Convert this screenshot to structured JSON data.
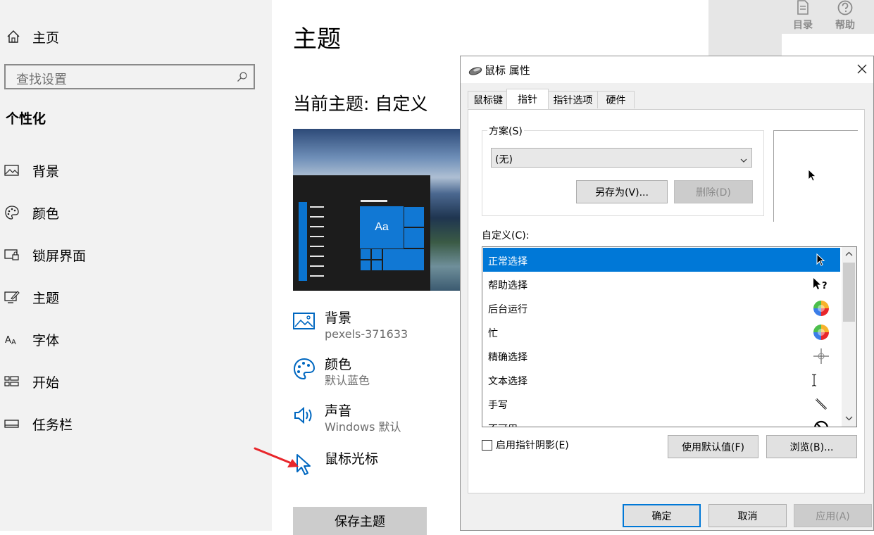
{
  "sidebar": {
    "home_label": "主页",
    "search_placeholder": "查找设置",
    "section_title": "个性化",
    "items": [
      {
        "label": "背景",
        "icon": "picture-icon"
      },
      {
        "label": "颜色",
        "icon": "palette-icon"
      },
      {
        "label": "锁屏界面",
        "icon": "lock-screen-icon"
      },
      {
        "label": "主题",
        "icon": "theme-icon"
      },
      {
        "label": "字体",
        "icon": "font-icon"
      },
      {
        "label": "开始",
        "icon": "start-icon"
      },
      {
        "label": "任务栏",
        "icon": "taskbar-icon"
      }
    ]
  },
  "main": {
    "title": "主题",
    "current_theme": "当前主题: 自定义",
    "preview_tile_text": "Aa",
    "rows": [
      {
        "label": "背景",
        "sub": "pexels-371633",
        "icon": "picture-icon"
      },
      {
        "label": "颜色",
        "sub": "默认蓝色",
        "icon": "palette-icon"
      },
      {
        "label": "声音",
        "sub": "Windows 默认",
        "icon": "speaker-icon"
      },
      {
        "label": "鼠标光标",
        "sub": "",
        "icon": "cursor-icon"
      }
    ],
    "save_button": "保存主题"
  },
  "help_window": {
    "toc": "目录",
    "help": "帮助"
  },
  "dialog": {
    "title": "鼠标 属性",
    "tabs": [
      "鼠标键",
      "指针",
      "指针选项",
      "硬件"
    ],
    "active_tab": "指针",
    "scheme_label": "方案(S)",
    "scheme_value": "(无)",
    "save_as_button": "另存为(V)...",
    "delete_button": "删除(D)",
    "customize_label": "自定义(C):",
    "cursor_list": [
      {
        "label": "正常选择",
        "icon": "arrow-cursor-icon"
      },
      {
        "label": "帮助选择",
        "icon": "help-cursor-icon"
      },
      {
        "label": "后台运行",
        "icon": "working-cursor-icon"
      },
      {
        "label": "忙",
        "icon": "busy-cursor-icon"
      },
      {
        "label": "精确选择",
        "icon": "crosshair-cursor-icon"
      },
      {
        "label": "文本选择",
        "icon": "text-cursor-icon"
      },
      {
        "label": "手写",
        "icon": "pen-cursor-icon"
      },
      {
        "label": "不可用",
        "icon": "unavailable-cursor-icon"
      }
    ],
    "selected_index": 0,
    "shadow_checkbox": "启用指针阴影(E)",
    "shadow_checked": false,
    "default_button": "使用默认值(F)",
    "browse_button": "浏览(B)...",
    "ok_button": "确定",
    "cancel_button": "取消",
    "apply_button": "应用(A)"
  },
  "colors": {
    "accent": "#0078d7",
    "sidebar_bg": "#f2f2f2",
    "annotation_arrow": "#e8262b"
  }
}
